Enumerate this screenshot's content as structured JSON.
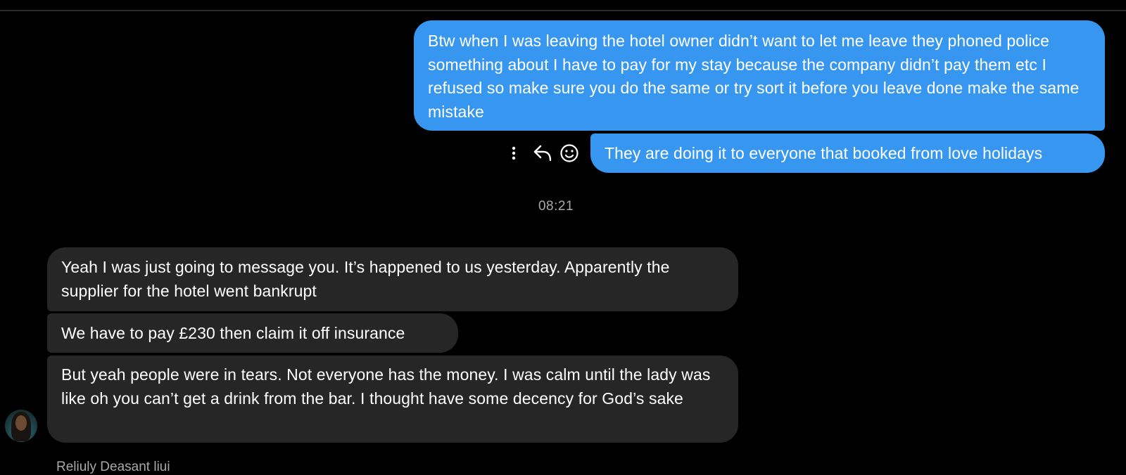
{
  "thread": {
    "messages": [
      {
        "direction": "outgoing",
        "text": "Btw when I was leaving the hotel owner didn’t want to let me leave they phoned police something about I have to pay for my stay because the company didn’t pay them etc I refused so make sure you do the same or try sort it before you leave done make the same mistake"
      },
      {
        "direction": "outgoing",
        "text": "They are doing it to everyone that booked from love holidays"
      },
      {
        "direction": "incoming",
        "text": "Yeah I was just going to message you. It’s happened to us yesterday. Apparently the supplier for the hotel went bankrupt"
      },
      {
        "direction": "incoming",
        "text": "We have to pay £230 then claim it off insurance"
      },
      {
        "direction": "incoming",
        "text": "But yeah people were in tears. Not everyone has the money. I was calm until the lady was like oh you can’t get a drink from the bar. I thought have some decency for God’s sake"
      }
    ],
    "timestamp": "08:21",
    "footer_partial": "Reliuly Deasant liui"
  },
  "message_actions": {
    "more": "more-options-icon",
    "reply": "reply-icon",
    "react": "emoji-react-icon"
  },
  "colors": {
    "background": "#000000",
    "outgoing_bubble": "#3797f0",
    "incoming_bubble": "#262626",
    "timestamp_text": "#a8a8a8"
  }
}
